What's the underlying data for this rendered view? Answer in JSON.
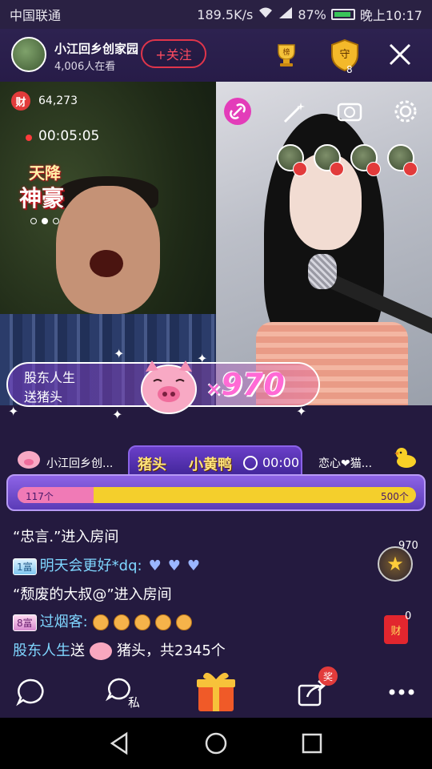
{
  "status": {
    "carrier": "中国联通",
    "net_speed": "189.5K/s",
    "battery": "87%",
    "time": "晚上10:17"
  },
  "header": {
    "room_name": "小江回乡创家园",
    "viewers": "4,006人在看",
    "follow_label": "+关注",
    "rank_label": "榜",
    "guard_label": "守",
    "guard_count": "8"
  },
  "left_stream": {
    "wealth_label": "财",
    "wealth_count": "64,273",
    "timer": "00:05:05",
    "promo_line1": "天降",
    "promo_line2": "神豪"
  },
  "gift_banner": {
    "sender": "股东人生",
    "action": "送猪头",
    "combo_prefix": "×",
    "combo_count": "970"
  },
  "pk": {
    "left_name": "小江回乡创...",
    "title_left": "猪头",
    "title_right": "小黄鸭",
    "time": "00:00",
    "right_name": "恋心❤猫...",
    "left_value": "117个",
    "right_value": "500个",
    "left_share": 0.19
  },
  "chat": [
    {
      "text": "“忠言.”进入房间"
    },
    {
      "level": "1富",
      "user": "明天会更好*dq:"
    },
    {
      "text": "“颓废的大叔@”进入房间"
    },
    {
      "level": "8富",
      "user": "过烟客:"
    },
    {
      "user": "股东人生",
      "verb": "送",
      "gift": "猪头，共2345个"
    }
  ],
  "floating": {
    "star_count": "970",
    "redpack_label": "财",
    "redpack_count": "0"
  },
  "toolbar": {
    "private_label": "私",
    "prize_label": "奖"
  }
}
